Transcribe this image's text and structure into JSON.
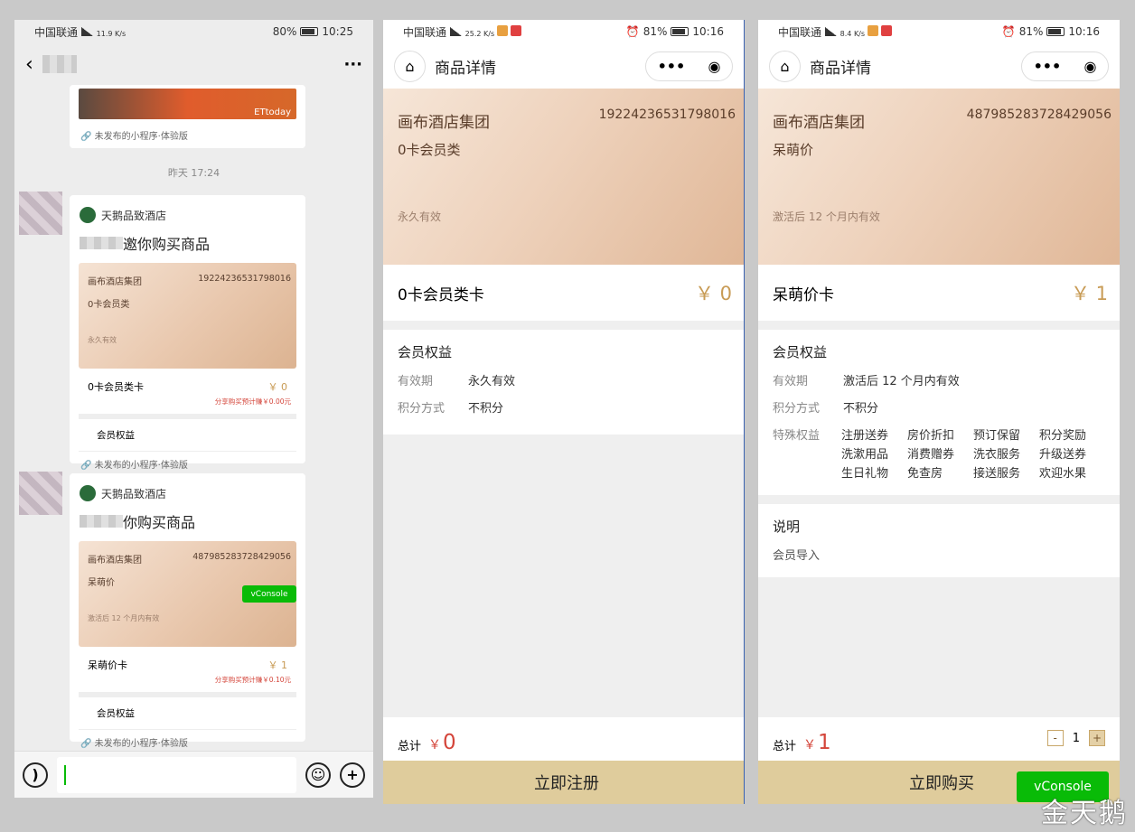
{
  "chat": {
    "status": {
      "carrier": "中国联通",
      "net": "4G",
      "speed": "11.9 K/s",
      "battery": "80%",
      "time": "10:25"
    },
    "more_label": "···",
    "top_footer": "未发布的小程序·体验版",
    "time_label": "昨天 17:24",
    "messages": [
      {
        "app": "天鹅品致酒店",
        "title": "邀你购买商品",
        "group": "画布酒店集团",
        "number": "19224236531798016",
        "card_type": "0卡会员类",
        "validity": "永久有效",
        "product": "0卡会员类卡",
        "price": "￥ 0",
        "share": "分享购买预计赚￥0.00元",
        "perks": "会员权益",
        "footer": "未发布的小程序·体验版"
      },
      {
        "app": "天鹅品致酒店",
        "title": "你购买商品",
        "group": "画布酒店集团",
        "number": "487985283728429056",
        "card_type": "呆萌价",
        "validity": "激活后 12 个月内有效",
        "product": "呆萌价卡",
        "price": "￥ 1",
        "share": "分享购买预计赚￥0.10元",
        "perks": "会员权益",
        "footer": "未发布的小程序·体验版",
        "vconsole": "vConsole"
      }
    ],
    "input": {
      "voice_icon": "voice-icon",
      "emoji_icon": "emoji-icon",
      "plus_icon": "plus-icon"
    }
  },
  "detail_a": {
    "status": {
      "carrier": "中国联通",
      "net": "4G",
      "speed": "25.2 K/s",
      "battery": "81%",
      "time": "10:16"
    },
    "nav_title": "商品详情",
    "group": "画布酒店集团",
    "number": "19224236531798016",
    "card_type": "0卡会员类",
    "validity": "永久有效",
    "product": "0卡会员类卡",
    "price": "￥ 0",
    "perks_title": "会员权益",
    "rows": [
      {
        "k": "有效期",
        "v": "永久有效"
      },
      {
        "k": "积分方式",
        "v": "不积分"
      }
    ],
    "total_label": "总计",
    "total_yen": "￥",
    "total_amount": "0",
    "action": "立即注册"
  },
  "detail_b": {
    "status": {
      "carrier": "中国联通",
      "net": "4G",
      "speed": "8.4 K/s",
      "battery": "81%",
      "time": "10:16"
    },
    "nav_title": "商品详情",
    "group": "画布酒店集团",
    "number": "487985283728429056",
    "card_type": "呆萌价",
    "validity": "激活后 12 个月内有效",
    "product": "呆萌价卡",
    "price": "￥ 1",
    "perks_title": "会员权益",
    "rows": [
      {
        "k": "有效期",
        "v": "激活后 12 个月内有效"
      },
      {
        "k": "积分方式",
        "v": "不积分"
      }
    ],
    "special_label": "特殊权益",
    "special": [
      "注册送券",
      "房价折扣",
      "预订保留",
      "积分奖励",
      "洗漱用品",
      "消费赠券",
      "洗衣服务",
      "升级送券",
      "生日礼物",
      "免查房",
      "接送服务",
      "欢迎水果"
    ],
    "desc_title": "说明",
    "desc": "会员导入",
    "total_label": "总计",
    "total_yen": "￥",
    "total_amount": "1",
    "qty": "1",
    "minus": "-",
    "plus": "+",
    "action": "立即购买",
    "vconsole": "vConsole"
  },
  "watermark": "金天鹅",
  "colors": {
    "accent_gold": "#c89b55",
    "price_red": "#d4453a",
    "button_bg": "#dfcc9c",
    "vconsole_green": "#09bb07"
  }
}
